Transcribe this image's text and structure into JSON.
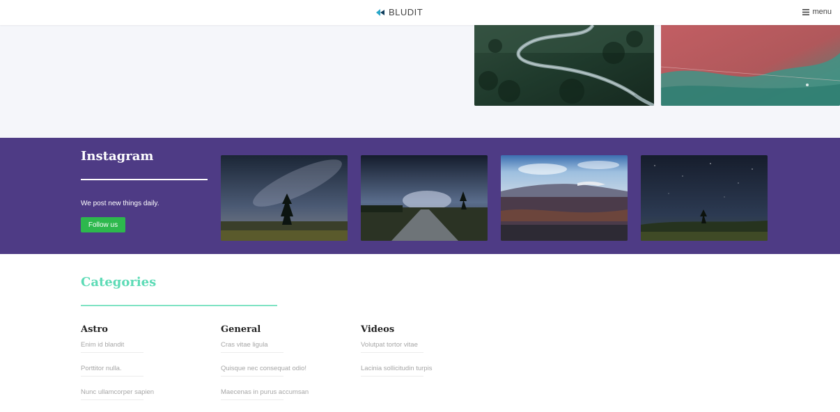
{
  "header": {
    "brand": "BLUDIT",
    "menu_label": "menu",
    "menu_icon": "hamburger-icon",
    "logo_icon": "bludit-logo-icon"
  },
  "instagram": {
    "title": "Instagram",
    "tagline": "We post new things daily.",
    "follow_label": "Follow us",
    "band_color": "#4e3b85",
    "button_color": "#2db84d"
  },
  "categories": {
    "title": "Categories",
    "accent_color": "#5ddbb6",
    "columns": [
      {
        "name": "Astro",
        "items": [
          "Enim id blandit",
          "Porttitor nulla.",
          "Nunc ullamcorper sapien"
        ]
      },
      {
        "name": "General",
        "items": [
          "Cras vitae ligula",
          "Quisque nec consequat odio!",
          "Maecenas in purus accumsan"
        ]
      },
      {
        "name": "Videos",
        "items": [
          "Volutpat tortor vitae",
          "Lacinia sollicitudin turpis"
        ]
      }
    ]
  }
}
